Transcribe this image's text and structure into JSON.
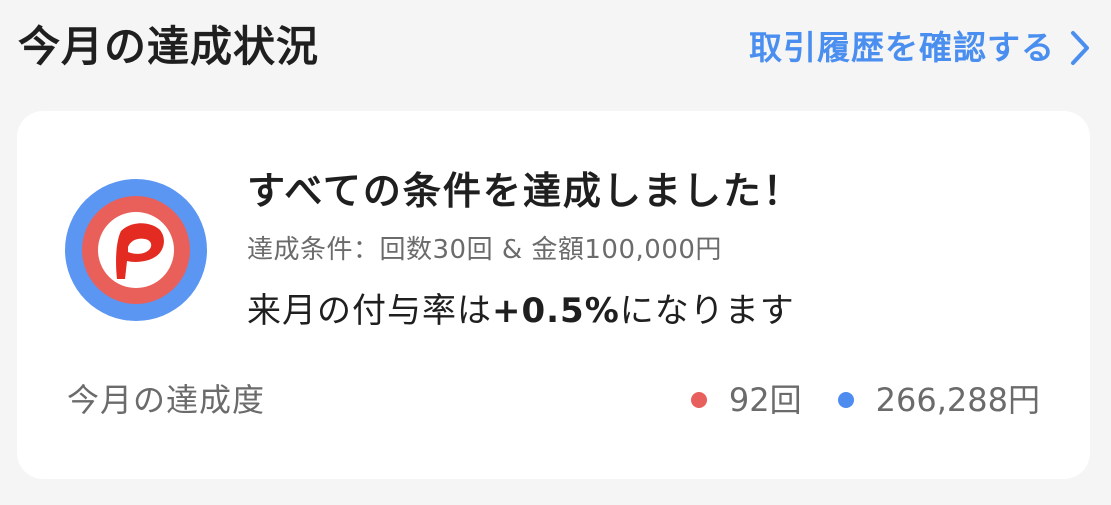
{
  "header": {
    "title": "今月の達成状況",
    "history_link": "取引履歴を確認する"
  },
  "card": {
    "headline": "すべての条件を達成しました！",
    "condition": "達成条件：回数30回 & 金額100,000円",
    "rate_prefix": "来月の付与率は",
    "rate_value": "+0.5%",
    "rate_suffix": "になります",
    "progress_label": "今月の達成度",
    "stats": {
      "count": "92回",
      "amount": "266,288円"
    }
  },
  "colors": {
    "accent_blue": "#4a8ff0",
    "badge_ring": "#5b96f2",
    "badge_fill": "#e9605b",
    "logo_red": "#e32b22",
    "count_dot": "#e8605e",
    "amount_dot": "#4f8cf0"
  },
  "icons": {
    "badge": "paypay-logo-icon",
    "link": "chevron-right-icon"
  }
}
